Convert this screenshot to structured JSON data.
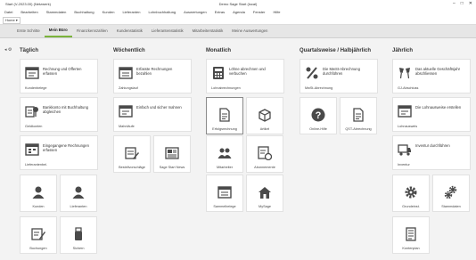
{
  "window": {
    "title_left": "Start (V-2023.00) (Netzwerk)",
    "title_center": "Demo Sage Start (local)",
    "controls": [
      "–",
      "□",
      "✕"
    ]
  },
  "menu": [
    "Datei",
    "Bearbeiten",
    "Stammdaten",
    "Buchhaltung",
    "Kunden",
    "Lieferanten",
    "Lohnbuchhaltung",
    "Auswertungen",
    "Extras",
    "Agenda",
    "Fenster",
    "Hilfe"
  ],
  "ribbon": {
    "home": "Home ▾"
  },
  "tabs": [
    "Erste Schritte",
    "Mein Büro",
    "Finanzkennzahlen",
    "Kundenstatistik",
    "Lieferantenstatistik",
    "Mitarbeiterstatistik",
    "Meine Auswertungen"
  ],
  "sections": {
    "daily": "Täglich",
    "weekly": "Wöchentlich",
    "monthly": "Monatlich",
    "quarterly": "Quartalsweise / Halbjährlich",
    "yearly": "Jährlich"
  },
  "tiles": {
    "rechnungen": {
      "text": "Rechnung und Offerten erfassen",
      "label": "Kundenbelege"
    },
    "bankkonto": {
      "text": "Bankkonto mit Buchhaltung abgleichen",
      "label": "Geldkonten"
    },
    "eingegangene": {
      "text": "Eingegangene Rechnungen erfassen",
      "label": "Lieferantenbel."
    },
    "kunden": {
      "label": "Kunden"
    },
    "lieferanten": {
      "label": "Lieferanten"
    },
    "buchungen": {
      "label": "Buchungen"
    },
    "sichern": {
      "label": "Sichern"
    },
    "erfasste": {
      "text": "Erfasste Rechnungen bezahlen",
      "label": "Zahlungslauf"
    },
    "mahnen": {
      "text": "Einfach und sicher mahnen",
      "label": "Mahnläufe"
    },
    "bestellvorschlaege": {
      "label": "Bestellvorschläge"
    },
    "sagestartnews": {
      "label": "Sage Start News"
    },
    "loehne": {
      "text": "Löhne abrechnen und verbuchen",
      "label": "Lohnabrechnungen"
    },
    "erfolgsrechnung": {
      "label": "Erfolgsrechnung"
    },
    "artikel": {
      "label": "Artikel"
    },
    "mitarbeiter": {
      "label": "Mitarbeiter"
    },
    "abonnemente": {
      "label": "Abonnemente"
    },
    "sammelbelege": {
      "label": "Sammelbelege"
    },
    "mysage": {
      "label": "MySage"
    },
    "mwst": {
      "text": "Die MwSt-Abrechnung durchführen",
      "label": "MwSt-Abrechnung"
    },
    "onlinehilfe": {
      "label": "Online-Hilfe"
    },
    "qst": {
      "label": "QST-Abrechnung"
    },
    "gj": {
      "text": "Das aktuelle Geschäftsjahr abschliessen",
      "label": "GJ-Abschluss"
    },
    "lohnausweise": {
      "text": "Die Lohnausweise erstellen",
      "label": "Lohnausweis"
    },
    "inventur": {
      "text": "Inventur durchführen",
      "label": "Inventur"
    },
    "grundeinst": {
      "label": "Grundeinst."
    },
    "stammdaten": {
      "label": "Stammdaten"
    },
    "kontenplan": {
      "label": "Kontenplan"
    }
  }
}
